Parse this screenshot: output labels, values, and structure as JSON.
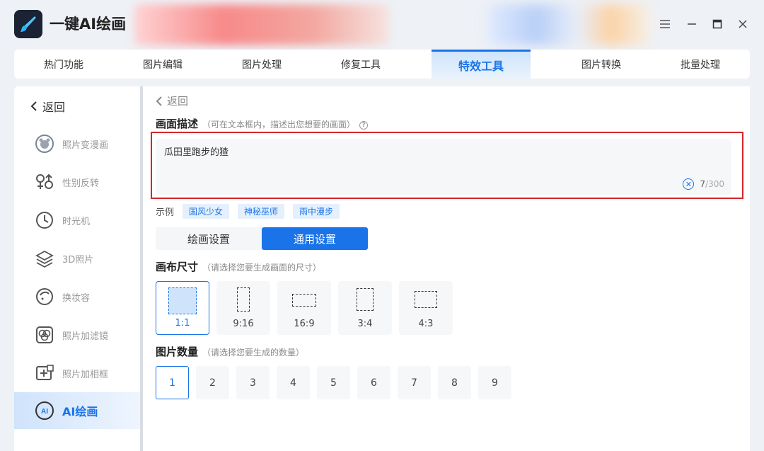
{
  "app": {
    "title": "一键AI绘画"
  },
  "window": {
    "menu_icon": "menu-icon",
    "min_icon": "minimize-icon",
    "max_icon": "maximize-icon",
    "close_icon": "close-icon"
  },
  "topnav": {
    "tabs": [
      {
        "label": "热门功能",
        "active": false
      },
      {
        "label": "图片编辑",
        "active": false
      },
      {
        "label": "图片处理",
        "active": false
      },
      {
        "label": "修复工具",
        "active": false
      },
      {
        "label": "特效工具",
        "active": true
      },
      {
        "label": "图片转换",
        "active": false
      },
      {
        "label": "批量处理",
        "active": false
      }
    ]
  },
  "sidebar": {
    "back_label": "返回",
    "items": [
      {
        "label": "照片变漫画",
        "icon": "bear-face-icon"
      },
      {
        "label": "性别反转",
        "icon": "gender-icon"
      },
      {
        "label": "时光机",
        "icon": "clock-icon"
      },
      {
        "label": "3D照片",
        "icon": "layers-icon"
      },
      {
        "label": "换妆容",
        "icon": "face-profile-icon"
      },
      {
        "label": "照片加滤镜",
        "icon": "filter-icon"
      },
      {
        "label": "照片加相框",
        "icon": "frame-plus-icon"
      },
      {
        "label": "AI绘画",
        "icon": "ai-paint-icon",
        "active": true
      }
    ]
  },
  "main": {
    "back_label": "返回",
    "description": {
      "title": "画面描述",
      "hint": "（可在文本框内，描述出您想要的画面）",
      "value": "瓜田里跑步的猹",
      "count_current": "7",
      "count_max": "/300"
    },
    "examples": {
      "label": "示例",
      "chips": [
        "国风少女",
        "神秘巫师",
        "雨中漫步"
      ]
    },
    "settings_tabs": [
      {
        "label": "绘画设置",
        "active": false
      },
      {
        "label": "通用设置",
        "active": true
      }
    ],
    "canvas_size": {
      "title": "画布尺寸",
      "hint": "（请选择您要生成画面的尺寸）",
      "options": [
        "1:1",
        "9:16",
        "16:9",
        "3:4",
        "4:3"
      ],
      "selected": "1:1"
    },
    "image_count": {
      "title": "图片数量",
      "hint": "（请选择您要生成的数量）",
      "options": [
        "1",
        "2",
        "3",
        "4",
        "5",
        "6",
        "7",
        "8",
        "9"
      ],
      "selected": "1"
    }
  },
  "colors": {
    "accent": "#1a73e8",
    "highlight": "#d6252a"
  }
}
